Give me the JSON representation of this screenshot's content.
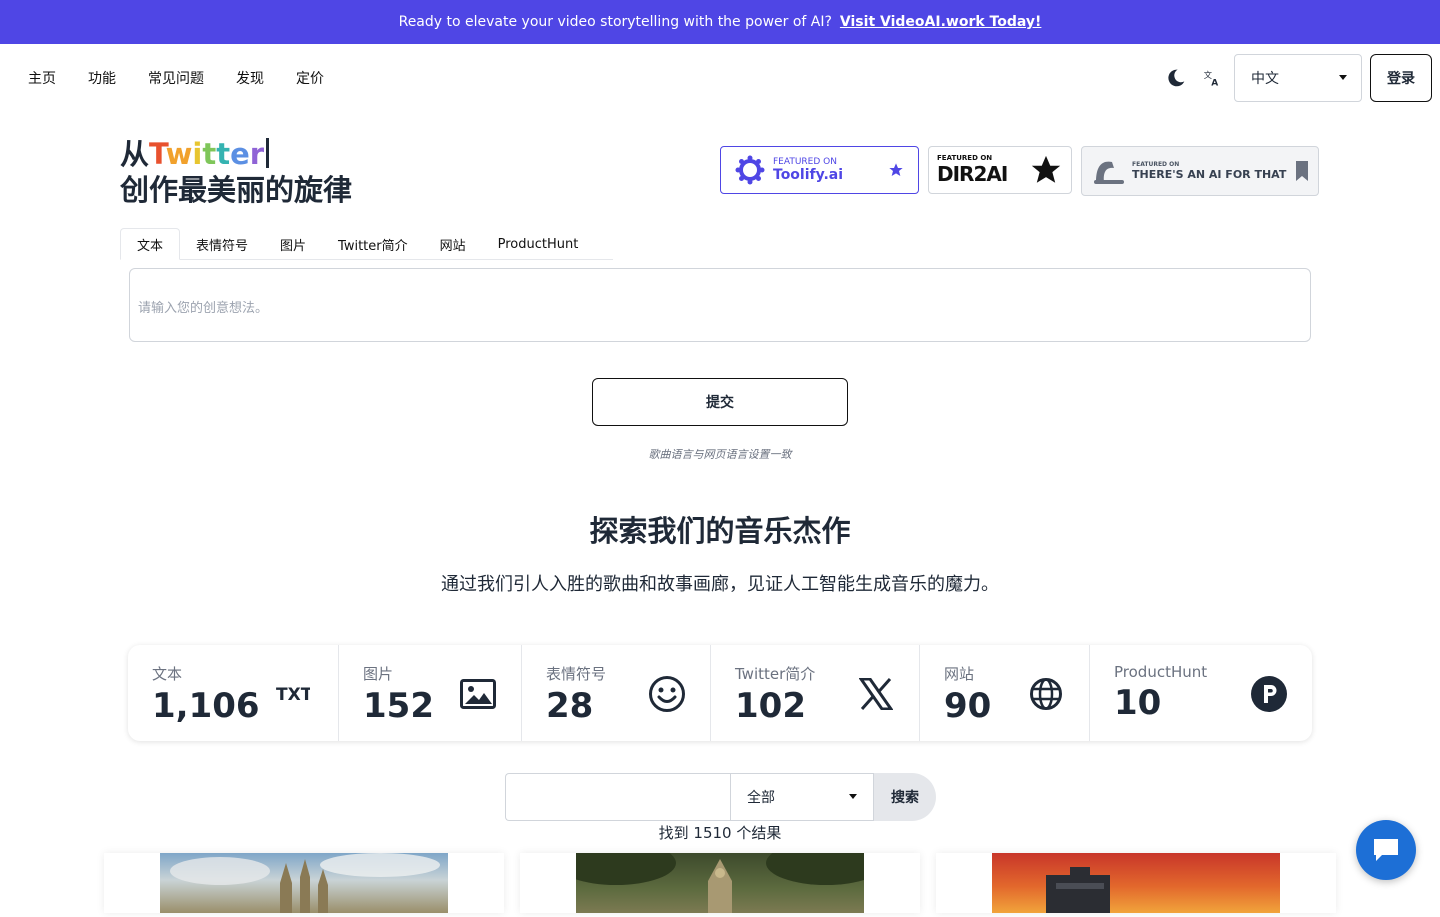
{
  "banner": {
    "text": "Ready to elevate your video storytelling with the power of AI?",
    "link": "Visit VideoAI.work Today!"
  },
  "nav": {
    "links": [
      "主页",
      "功能",
      "常见问题",
      "发现",
      "定价"
    ],
    "language": "中文",
    "login": "登录"
  },
  "hero": {
    "prefix": "从",
    "rainbow_word": "Twitter",
    "line2": "创作最美丽的旋律"
  },
  "badges": {
    "toolify": {
      "top": "FEATURED ON",
      "name": "Toolify.ai"
    },
    "dir2ai": {
      "top": "FEATURED ON",
      "name": "DIR2AI"
    },
    "taaft": {
      "top": "FEATURED ON",
      "name": "THERE'S AN AI FOR THAT"
    }
  },
  "tabs": [
    "文本",
    "表情符号",
    "图片",
    "Twitter简介",
    "网站",
    "ProductHunt"
  ],
  "input": {
    "placeholder": "请输入您的创意想法。"
  },
  "submit": "提交",
  "note": "歌曲语言与网页语言设置一致",
  "section": {
    "title": "探索我们的音乐杰作",
    "subtitle": "通过我们引人入胜的歌曲和故事画廊，见证人工智能生成音乐的魔力。"
  },
  "stats": [
    {
      "label": "文本",
      "value": "1,106",
      "icon": "txt-icon"
    },
    {
      "label": "图片",
      "value": "152",
      "icon": "image-icon"
    },
    {
      "label": "表情符号",
      "value": "28",
      "icon": "smiley-icon"
    },
    {
      "label": "Twitter简介",
      "value": "102",
      "icon": "x-logo-icon"
    },
    {
      "label": "网站",
      "value": "90",
      "icon": "globe-icon"
    },
    {
      "label": "ProductHunt",
      "value": "10",
      "icon": "producthunt-icon"
    }
  ],
  "search": {
    "select": "全部",
    "button": "搜索",
    "results": "找到 1510 个结果"
  },
  "colors": {
    "banner": "#4f46e5",
    "chat": "#1d6fd6",
    "rainbow": [
      "#e8512e",
      "#f1a12c",
      "#e7c52f",
      "#7fc65a",
      "#35b3b1",
      "#5b8fe3",
      "#8f63d6"
    ]
  }
}
